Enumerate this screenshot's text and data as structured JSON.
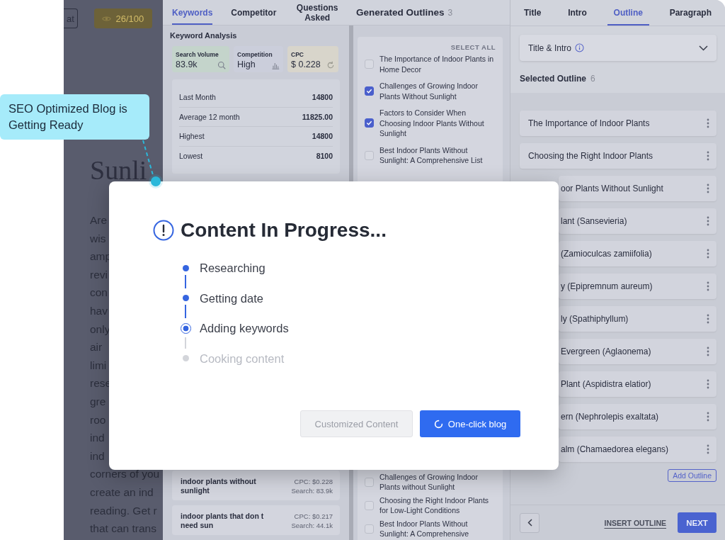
{
  "document": {
    "top_buttons": [
      {
        "label": "at",
        "kind": "outline"
      },
      {
        "label": "26/100",
        "kind": "score"
      }
    ],
    "title_lines": [
      "Sunli"
    ],
    "body_lines": [
      "Are",
      "wis",
      "amp",
      "revi",
      "con",
      "hav",
      "only",
      "air",
      "limi",
      "rese",
      "gre",
      "roo",
      "ind",
      "ind",
      "corners of you",
      "create an ind",
      "reading. Get r",
      "that can trans"
    ]
  },
  "research_tabs": [
    {
      "label": "Keywords",
      "selected": true
    },
    {
      "label": "Competitor",
      "selected": false
    },
    {
      "label": "Questions Asked",
      "selected": false
    }
  ],
  "keyword_analysis": {
    "title": "Keyword Analysis",
    "stats": [
      {
        "label": "Search Volume",
        "value": "83.9k",
        "kind": "search",
        "color": "#c4d4cb"
      },
      {
        "label": "Competition",
        "value": "High",
        "kind": "bars",
        "color": "#cbcedb"
      },
      {
        "label": "CPC",
        "value": "$ 0.228",
        "kind": "refresh",
        "color": "#d8d5cb"
      }
    ],
    "rows": [
      {
        "label": "Last Month",
        "value": "14800"
      },
      {
        "label": "Average 12 month",
        "value": "11825.00"
      },
      {
        "label": "Highest",
        "value": "14800"
      },
      {
        "label": "Lowest",
        "value": "8100"
      }
    ],
    "keywords": [
      {
        "keyword": "indoor plants without sunlight",
        "cpc": "CPC: $0.228",
        "search": "Search: 83.9k"
      },
      {
        "keyword": "indoor plants that don t need sun",
        "cpc": "CPC: $0.217",
        "search": "Search: 44.1k"
      }
    ]
  },
  "generated_outlines": {
    "title": "Generated Outlines",
    "count": "3",
    "select_all": "SELECT ALL",
    "items": [
      {
        "text": "The Importance of Indoor Plants in Home Decor",
        "checked": false
      },
      {
        "text": "Challenges of Growing Indoor Plants Without Sunlight",
        "checked": true
      },
      {
        "text": "Factors to Consider When Choosing Indoor Plants Without Sunlight",
        "checked": true
      },
      {
        "text": "Best Indoor Plants Without Sunlight: A Comprehensive List",
        "checked": false
      }
    ],
    "more_items": [
      {
        "text": "Challenges of Growing Indoor Plants without Sunlight",
        "checked": false
      },
      {
        "text": "Choosing the Right Indoor Plants for Low-Light Conditions",
        "checked": false
      },
      {
        "text": "Best Indoor Plants Without Sunlight: A Comprehensive",
        "checked": false
      }
    ]
  },
  "editor": {
    "tabs": [
      {
        "label": "Title",
        "selected": false
      },
      {
        "label": "Intro",
        "selected": false
      },
      {
        "label": "Outline",
        "selected": true
      },
      {
        "label": "Paragraph",
        "selected": false
      }
    ],
    "dropdown": "Title & Intro",
    "selected_outline": {
      "title": "Selected Outline",
      "count": "6"
    },
    "outline_items": [
      "The Importance of Indoor Plants",
      "Choosing the Right Indoor Plants",
      "oor Plants Without Sunlight",
      "lant (Sansevieria)",
      "(Zamioculcas zamiifolia)",
      "y (Epipremnum aureum)",
      "ly (Spathiphyllum)",
      "Evergreen (Aglaonema)",
      "Plant (Aspidistra elatior)",
      "ern (Nephrolepis exaltata)",
      "alm (Chamaedorea elegans)"
    ],
    "add_button": "Add Outline",
    "insert_link": "INSERT OUTLINE",
    "next_button": "NEXT"
  },
  "modal": {
    "title": "Content In Progress...",
    "steps": [
      {
        "label": "Researching",
        "done": true,
        "active": false
      },
      {
        "label": "Getting date",
        "done": true,
        "active": false
      },
      {
        "label": "Adding keywords",
        "done": false,
        "active": true
      },
      {
        "label": "Cooking content",
        "done": false,
        "active": false
      }
    ],
    "buttons": [
      {
        "label": "Customized Content",
        "kind": "disabled"
      },
      {
        "label": "One-click blog",
        "kind": "primary"
      }
    ]
  },
  "callout": {
    "text": "SEO Optimized Blog is Getting Ready"
  }
}
